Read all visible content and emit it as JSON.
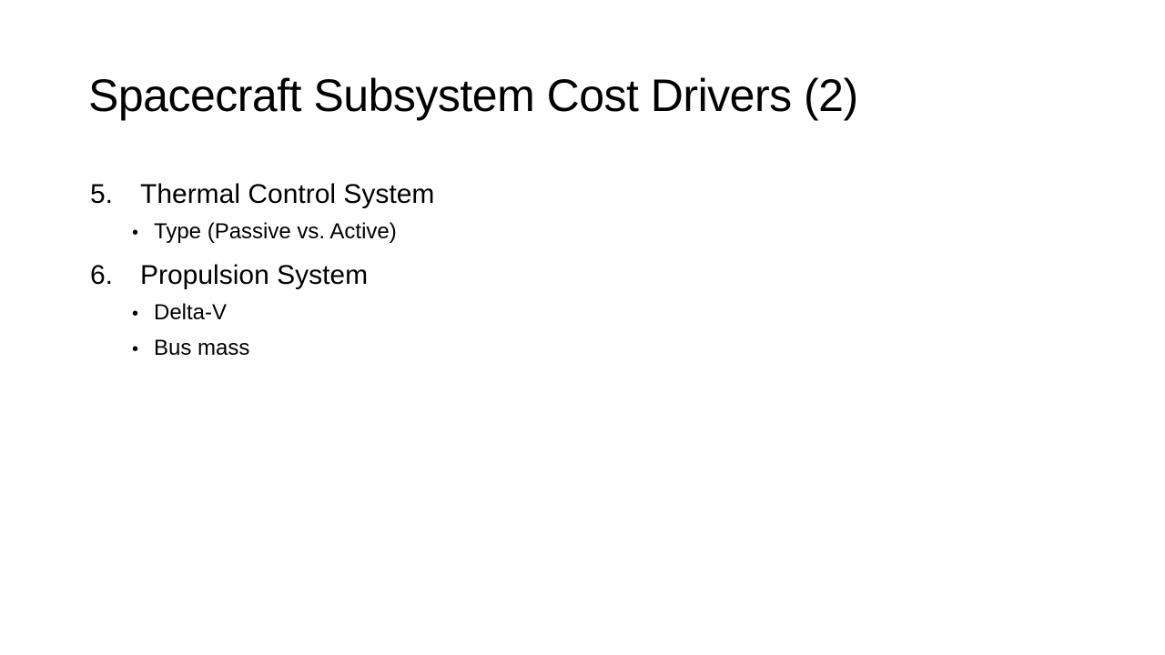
{
  "slide": {
    "title": "Spacecraft Subsystem Cost Drivers (2)",
    "items": [
      {
        "number": "5.",
        "label": "Thermal Control System",
        "bullets": [
          "Type (Passive vs. Active)"
        ]
      },
      {
        "number": "6.",
        "label": "Propulsion System",
        "bullets": [
          "Delta-V",
          "Bus mass"
        ]
      }
    ]
  }
}
